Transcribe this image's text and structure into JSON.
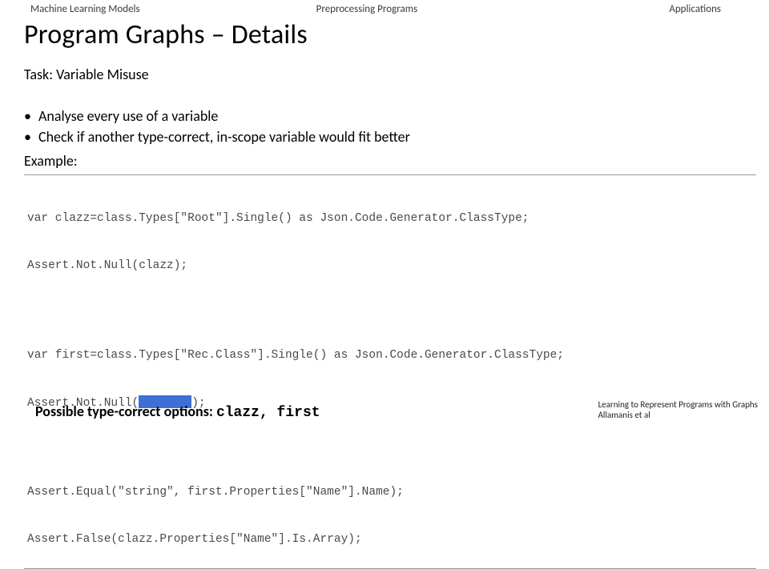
{
  "tabs": {
    "t1": "Machine Learning Models",
    "t2": "Preprocessing Programs",
    "t3": "Applications"
  },
  "title": "Program Graphs – Details",
  "task": "Task: Variable Misuse",
  "bullets": {
    "b1": "Analyse every use of a variable",
    "b2": "Check if another type-correct, in-scope variable would fit better"
  },
  "example_label": "Example:",
  "code": {
    "l1": "var clazz=class.Types[\"Root\"].Single() as Json.Code.Generator.ClassType;",
    "l2": "Assert.Not.Null(clazz);",
    "l3a": "var first=class.Types[\"Rec.Class\"].Single() as Json.Code.Generator.ClassType;",
    "l4pre": "Assert.Not.Null(",
    "l4post": ");",
    "l5": "Assert.Equal(\"string\", first.Properties[\"Name\"].Name);",
    "l6": "Assert.False(clazz.Properties[\"Name\"].Is.Array);"
  },
  "options": {
    "label": "Possible type-correct options: ",
    "values": "clazz, first"
  },
  "citation": {
    "line1": "Learning to Represent Programs with Graphs",
    "line2": "Allamanis et al"
  }
}
